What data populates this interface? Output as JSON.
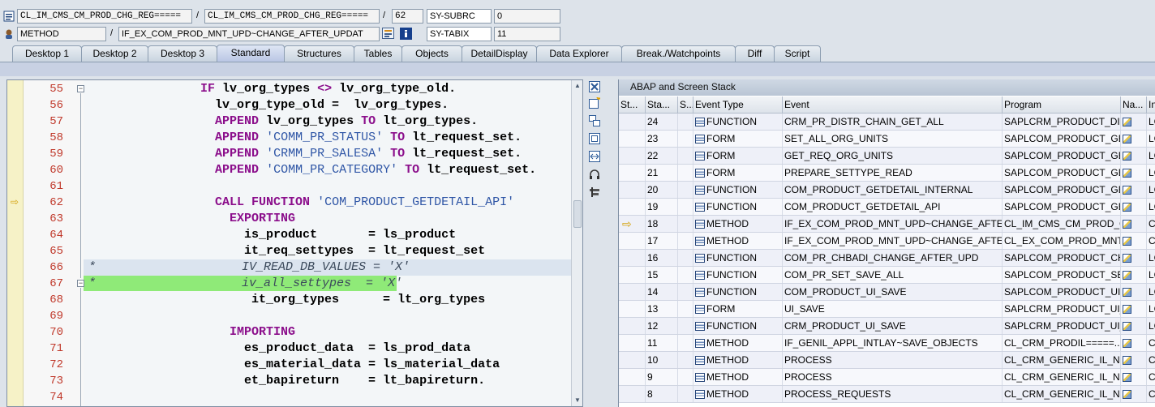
{
  "header": {
    "row1": {
      "class_field": "CL_IM_CMS_CM_PROD_CHG_REG=====",
      "include_field": "CL_IM_CMS_CM_PROD_CHG_REG=====",
      "line_field": "62",
      "var_name": "SY-SUBRC",
      "var_value": "0"
    },
    "row2": {
      "type_field": "METHOD",
      "method_field": "IF_EX_COM_PROD_MNT_UPD~CHANGE_AFTER_UPDAT",
      "var_name": "SY-TABIX",
      "var_value": "11"
    }
  },
  "tabs": [
    {
      "label": "Desktop 1"
    },
    {
      "label": "Desktop 2"
    },
    {
      "label": "Desktop 3"
    },
    {
      "label": "Standard"
    },
    {
      "label": "Structures"
    },
    {
      "label": "Tables"
    },
    {
      "label": "Objects"
    },
    {
      "label": "DetailDisplay"
    },
    {
      "label": "Data Explorer"
    },
    {
      "label": "Break./Watchpoints"
    },
    {
      "label": "Diff"
    },
    {
      "label": "Script"
    }
  ],
  "active_tab": "Standard",
  "code": {
    "current_line": "62",
    "lines": [
      {
        "num": "55",
        "parts": [
          [
            "",
            "                "
          ],
          [
            "kw",
            "IF"
          ],
          [
            "",
            " lv_org_types "
          ],
          [
            "kw",
            "<>"
          ],
          [
            "",
            " lv_org_type_old."
          ]
        ]
      },
      {
        "num": "56",
        "parts": [
          [
            "",
            "                  lv_org_type_old =  lv_org_types."
          ]
        ]
      },
      {
        "num": "57",
        "parts": [
          [
            "",
            "                  "
          ],
          [
            "kw",
            "APPEND"
          ],
          [
            "",
            " lv_org_types "
          ],
          [
            "kw",
            "TO"
          ],
          [
            "",
            " lt_org_types."
          ]
        ]
      },
      {
        "num": "58",
        "parts": [
          [
            "",
            "                  "
          ],
          [
            "kw",
            "APPEND"
          ],
          [
            "",
            " "
          ],
          [
            "str",
            "'COMM_PR_STATUS'"
          ],
          [
            "",
            " "
          ],
          [
            "kw",
            "TO"
          ],
          [
            "",
            " lt_request_set."
          ]
        ]
      },
      {
        "num": "59",
        "parts": [
          [
            "",
            "                  "
          ],
          [
            "kw",
            "APPEND"
          ],
          [
            "",
            " "
          ],
          [
            "str",
            "'CRMM_PR_SALESA'"
          ],
          [
            "",
            " "
          ],
          [
            "kw",
            "TO"
          ],
          [
            "",
            " lt_request_set."
          ]
        ]
      },
      {
        "num": "60",
        "parts": [
          [
            "",
            "                  "
          ],
          [
            "kw",
            "APPEND"
          ],
          [
            "",
            " "
          ],
          [
            "str",
            "'COMM_PR_CATEGORY'"
          ],
          [
            "",
            " "
          ],
          [
            "kw",
            "TO"
          ],
          [
            "",
            " lt_request_set."
          ]
        ]
      },
      {
        "num": "61",
        "parts": [
          [
            "",
            ""
          ]
        ]
      },
      {
        "num": "62",
        "parts": [
          [
            "",
            "                  "
          ],
          [
            "kw",
            "CALL FUNCTION"
          ],
          [
            "",
            " "
          ],
          [
            "str",
            "'COM_PRODUCT_GETDETAIL_API'"
          ]
        ]
      },
      {
        "num": "63",
        "parts": [
          [
            "",
            "                    "
          ],
          [
            "kw",
            "EXPORTING"
          ]
        ]
      },
      {
        "num": "64",
        "parts": [
          [
            "",
            "                      is_product       = ls_product"
          ]
        ]
      },
      {
        "num": "65",
        "parts": [
          [
            "",
            "                      it_req_settypes  = lt_request_set"
          ]
        ]
      },
      {
        "num": "66",
        "comment": "*                    IV_READ_DB_VALUES = 'X'"
      },
      {
        "num": "67",
        "comment": "*                    iv_all_settypes  = 'X'"
      },
      {
        "num": "68",
        "parts": [
          [
            "",
            "                       it_org_types      = lt_org_types"
          ]
        ]
      },
      {
        "num": "69",
        "parts": [
          [
            "",
            ""
          ]
        ]
      },
      {
        "num": "70",
        "parts": [
          [
            "",
            "                    "
          ],
          [
            "kw",
            "IMPORTING"
          ]
        ]
      },
      {
        "num": "71",
        "parts": [
          [
            "",
            "                      es_product_data  = ls_prod_data"
          ]
        ]
      },
      {
        "num": "72",
        "parts": [
          [
            "",
            "                      es_material_data = ls_material_data"
          ]
        ]
      },
      {
        "num": "73",
        "parts": [
          [
            "",
            "                      et_bapireturn    = lt_bapireturn."
          ]
        ]
      },
      {
        "num": "74",
        "parts": [
          [
            "",
            ""
          ]
        ]
      }
    ]
  },
  "stack": {
    "title": "ABAP and Screen Stack",
    "columns": [
      "St...",
      "Sta...",
      "S...",
      "Event Type",
      "Event",
      "Program",
      "Na...",
      "In"
    ],
    "rows": [
      {
        "st": "",
        "level": "24",
        "type": "FUNCTION",
        "event": "CRM_PR_DISTR_CHAIN_GET_ALL",
        "program": "SAPLCRM_PRODUCT_DIS...",
        "inc": "LC"
      },
      {
        "st": "",
        "level": "23",
        "type": "FORM",
        "event": "SET_ALL_ORG_UNITS",
        "program": "SAPLCOM_PRODUCT_GE...",
        "inc": "LC"
      },
      {
        "st": "",
        "level": "22",
        "type": "FORM",
        "event": "GET_REQ_ORG_UNITS",
        "program": "SAPLCOM_PRODUCT_GE...",
        "inc": "LC"
      },
      {
        "st": "",
        "level": "21",
        "type": "FORM",
        "event": "PREPARE_SETTYPE_READ",
        "program": "SAPLCOM_PRODUCT_GE...",
        "inc": "LC"
      },
      {
        "st": "",
        "level": "20",
        "type": "FUNCTION",
        "event": "COM_PRODUCT_GETDETAIL_INTERNAL",
        "program": "SAPLCOM_PRODUCT_GE...",
        "inc": "LC"
      },
      {
        "st": "",
        "level": "19",
        "type": "FUNCTION",
        "event": "COM_PRODUCT_GETDETAIL_API",
        "program": "SAPLCOM_PRODUCT_GE...",
        "inc": "LC"
      },
      {
        "st": "arrow",
        "level": "18",
        "type": "METHOD",
        "event": "IF_EX_COM_PROD_MNT_UPD~CHANGE_AFTER...",
        "program": "CL_IM_CMS_CM_PROD_C...",
        "inc": "CL"
      },
      {
        "st": "",
        "level": "17",
        "type": "METHOD",
        "event": "IF_EX_COM_PROD_MNT_UPD~CHANGE_AFTER...",
        "program": "CL_EX_COM_PROD_MNT...",
        "inc": "CL"
      },
      {
        "st": "",
        "level": "16",
        "type": "FUNCTION",
        "event": "COM_PR_CHBADI_CHANGE_AFTER_UPD",
        "program": "SAPLCOM_PRODUCT_CH...",
        "inc": "LC"
      },
      {
        "st": "",
        "level": "15",
        "type": "FUNCTION",
        "event": "COM_PR_SET_SAVE_ALL",
        "program": "SAPLCOM_PRODUCT_SET",
        "inc": "LC"
      },
      {
        "st": "",
        "level": "14",
        "type": "FUNCTION",
        "event": "COM_PRODUCT_UI_SAVE",
        "program": "SAPLCOM_PRODUCT_UI...",
        "inc": "LC"
      },
      {
        "st": "",
        "level": "13",
        "type": "FORM",
        "event": "UI_SAVE",
        "program": "SAPLCRM_PRODUCT_UI_...",
        "inc": "LC"
      },
      {
        "st": "",
        "level": "12",
        "type": "FUNCTION",
        "event": "CRM_PRODUCT_UI_SAVE",
        "program": "SAPLCRM_PRODUCT_UI_...",
        "inc": "LC"
      },
      {
        "st": "",
        "level": "11",
        "type": "METHOD",
        "event": "IF_GENIL_APPL_INTLAY~SAVE_OBJECTS",
        "program": "CL_CRM_PRODIL=====...",
        "inc": "CL"
      },
      {
        "st": "",
        "level": "10",
        "type": "METHOD",
        "event": "PROCESS",
        "program": "CL_CRM_GENERIC_IL_NE...",
        "inc": "CL"
      },
      {
        "st": "",
        "level": "9",
        "type": "METHOD",
        "event": "PROCESS",
        "program": "CL_CRM_GENERIC_IL_NE...",
        "inc": "CL"
      },
      {
        "st": "",
        "level": "8",
        "type": "METHOD",
        "event": "PROCESS_REQUESTS",
        "program": "CL_CRM_GENERIC_IL_NE...",
        "inc": "CL"
      }
    ]
  }
}
